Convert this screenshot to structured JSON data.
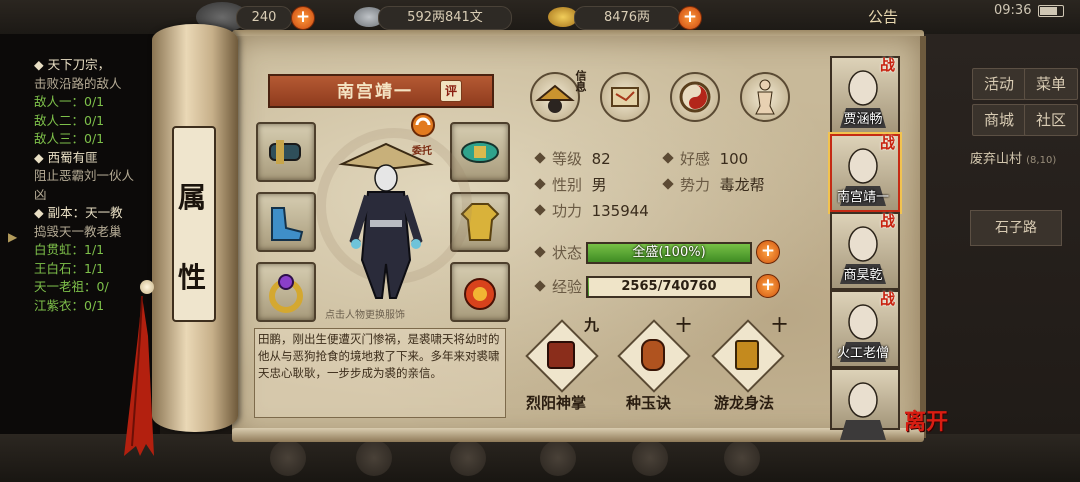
{
  "topbar": {
    "stamina": "240",
    "silver": "592两841文",
    "gold": "8476两",
    "notice": "公告",
    "time": "09:36"
  },
  "quest": {
    "lines": [
      {
        "text": "◆ 天下刀宗，",
        "kind": "head"
      },
      {
        "text": "击败沿路的敌人",
        "kind": "sub"
      },
      {
        "text": "敌人一：0/1",
        "kind": "goal"
      },
      {
        "text": "敌人二：0/1",
        "kind": "goal"
      },
      {
        "text": "敌人三：0/1",
        "kind": "goal"
      },
      {
        "text": "◆ 西蜀有匪",
        "kind": "head"
      },
      {
        "text": "阻止恶霸刘一伙人",
        "kind": "sub"
      },
      {
        "text": "凶",
        "kind": "sub"
      },
      {
        "text": "◆ 副本：天一教",
        "kind": "head"
      },
      {
        "text": "捣毁天一教老巢",
        "kind": "sub"
      },
      {
        "text": "白贯虹：1/1",
        "kind": "goal"
      },
      {
        "text": "王白石：1/1",
        "kind": "goal"
      },
      {
        "text": "天一老祖：0/",
        "kind": "goal"
      },
      {
        "text": "江紫衣：0/1",
        "kind": "goal"
      }
    ]
  },
  "right_menu": {
    "buttons": [
      "活动",
      "菜单",
      "商城",
      "社区"
    ],
    "location": "废弃山村",
    "coords": "(8,10)",
    "road": "石子路"
  },
  "scroll": {
    "label_top": "属",
    "label_bottom": "性"
  },
  "character": {
    "name": "南宫靖一",
    "eval_badge": "评",
    "entrust_label": "委托",
    "change_outfit_hint": "点击人物更换服饰",
    "info_label": "信息"
  },
  "stats": {
    "level_label": "等级",
    "level": "82",
    "favor_label": "好感",
    "favor": "100",
    "gender_label": "性别",
    "gender": "男",
    "faction_label": "势力",
    "faction": "毒龙帮",
    "power_label": "功力",
    "power": "135944"
  },
  "bars": {
    "status_label": "状态",
    "status_text": "全盛(100%)",
    "status_pct": 1.0,
    "exp_label": "经验",
    "exp_text": "2565/740760",
    "exp_pct": 0.0035
  },
  "bio": "田鹏，刚出生便遭灭门惨祸，是裘啸天将幼时的他从与恶狗抢食的境地救了下来。多年来对裘啸天忠心耿耿，一步步成为裘的亲信。",
  "skills": [
    {
      "name": "烈阳神掌",
      "rank": "九",
      "color": "#8a2d1b"
    },
    {
      "name": "种玉诀",
      "rank": "十",
      "color": "#b0531f"
    },
    {
      "name": "游龙身法",
      "rank": "十",
      "color": "#c48a1e"
    }
  ],
  "party": [
    {
      "name": "贾涵畅",
      "selected": false
    },
    {
      "name": "南宫靖一",
      "selected": true
    },
    {
      "name": "商昊乾",
      "selected": false
    },
    {
      "name": "火工老僧",
      "selected": false
    },
    {
      "name": "",
      "selected": false
    }
  ],
  "party_badge": "战",
  "leave_label": "离开",
  "colors": {
    "accent": "#c42a14",
    "status_fill": "#5aa832",
    "plus_orange": "#e0651a",
    "parchment": "#c8b999"
  }
}
